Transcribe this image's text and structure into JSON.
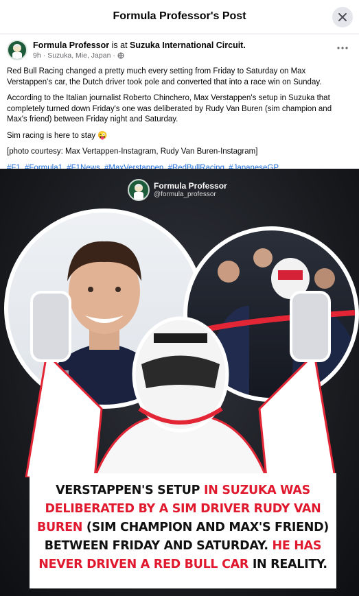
{
  "modal": {
    "title": "Formula Professor's Post"
  },
  "post": {
    "author": "Formula Professor",
    "is_at": "is at",
    "location_tag": "Suzuka International Circuit.",
    "time": "9h",
    "place": "Suzuka, Mie, Japan",
    "privacy_icon": "globe-icon",
    "paragraphs": [
      "Red Bull Racing changed a pretty much every setting from Friday to Saturday on Max Verstappen's car, the Dutch driver took pole and converted that into a race win on Sunday.",
      "According to the Italian journalist Roberto Chinchero, Max Verstappen's setup in Suzuka that completely turned down Friday's one was deliberated by Rudy Van Buren (sim champion and Max's friend) between Friday night and Saturday.",
      "Sim racing is here to stay 😜",
      "[photo courtesy: Max Vertappen-Instagram, Rudy Van Buren-Instagram]"
    ],
    "hashtags": [
      "#F1",
      "#Formula1",
      "#F1News",
      "#MaxVerstappen",
      "#RedBullRacing",
      "#JapaneseGP"
    ]
  },
  "photo": {
    "brand_name": "Formula Professor",
    "brand_handle": "@formula_professor",
    "caption_parts": [
      {
        "text": "Verstappen's setup ",
        "color": "black"
      },
      {
        "text": "in Suzuka was deliberated by a sim driver Rudy Van Buren ",
        "color": "red"
      },
      {
        "text": "(sim champion and Max's friend) between Friday and Saturday. ",
        "color": "black"
      },
      {
        "text": "He has never driven a red bull car ",
        "color": "red"
      },
      {
        "text": "in reality.",
        "color": "black"
      }
    ],
    "colors": {
      "red": "#e0192e",
      "black": "#111111",
      "link": "#216fdb"
    }
  }
}
